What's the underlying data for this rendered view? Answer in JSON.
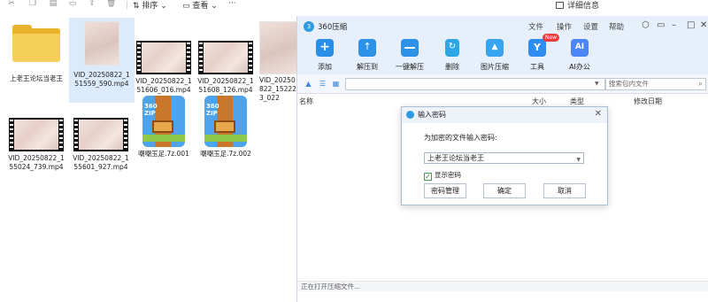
{
  "explorer": {
    "toolbar": {
      "sort_label": "排序",
      "view_label": "查看",
      "more_label": "···",
      "details_label": "详细信息",
      "icons": [
        "cut-icon",
        "copy-icon",
        "paste-icon",
        "rename-icon",
        "share-icon",
        "delete-icon"
      ]
    },
    "files": [
      {
        "name": "上老王论坛当老王",
        "type": "folder"
      },
      {
        "name": "VID_20250822_151559_590.mp4",
        "type": "portrait",
        "selected": true
      },
      {
        "name": "VID_20250822_151606_016.mp4",
        "type": "video"
      },
      {
        "name": "VID_20250822_151608_126.mp4",
        "type": "video"
      },
      {
        "name": "VID_20250822_152223_022",
        "type": "video"
      },
      {
        "name": "VID_20250822_155024_739.mp4",
        "type": "video"
      },
      {
        "name": "VID_20250822_155601_927.mp4",
        "type": "video"
      },
      {
        "name": "嘲嘲玉足.7z.001",
        "type": "zip"
      },
      {
        "name": "嘲嘲玉足.7z.002",
        "type": "zip"
      }
    ],
    "zip_icon_label_1": "360",
    "zip_icon_label_2": "ZIP"
  },
  "zipper": {
    "title": "360压缩",
    "logo": "3",
    "menu": [
      "文件",
      "操作",
      "设置",
      "帮助"
    ],
    "toolbar": [
      {
        "label": "添加",
        "icon": "add-icon"
      },
      {
        "label": "解压到",
        "icon": "extract-to-icon"
      },
      {
        "label": "一键解压",
        "icon": "one-click-extract-icon"
      },
      {
        "label": "删除",
        "icon": "delete-icon"
      },
      {
        "label": "图片压缩",
        "icon": "image-compress-icon"
      },
      {
        "label": "工具",
        "icon": "tools-icon",
        "badge": "New"
      },
      {
        "label": "AI办公",
        "icon": "ai-office-icon"
      }
    ],
    "search_placeholder": "搜索包内文件",
    "columns": {
      "name": "名称",
      "size": "大小",
      "type": "类型",
      "modified": "修改日期"
    },
    "status": "正在打开压缩文件..."
  },
  "dialog": {
    "title": "输入密码",
    "prompt": "为加密的文件输入密码:",
    "password_value": "上老王论坛当老王",
    "show_password_label": "显示密码",
    "show_password_checked": true,
    "buttons": {
      "manage": "密码管理",
      "ok": "确定",
      "cancel": "取消"
    }
  },
  "colors": {
    "accent": "#2b8ee6",
    "header_bg": "#e7f0fa",
    "selection": "#dcebfb"
  }
}
